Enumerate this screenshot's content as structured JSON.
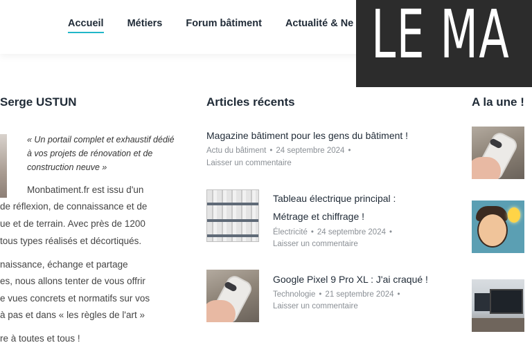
{
  "nav": {
    "items": [
      {
        "label": "Accueil",
        "active": true
      },
      {
        "label": "Métiers",
        "active": false
      },
      {
        "label": "Forum bâtiment",
        "active": false
      },
      {
        "label": "Actualité & Ne",
        "active": false
      }
    ],
    "accent_color": "#21b6c8"
  },
  "banner": {
    "text": "LE MA"
  },
  "about": {
    "title": "Serge USTUN",
    "quote": "« Un portail complet et exhaustif dédié à vos projets de rénovation et de construction neuve »",
    "lines": [
      "Monbatiment.fr est issu d'un",
      "de réflexion, de connaissance et de",
      "ue et de terrain. Avec près de 1200",
      "tous types réalisés et décortiqués.",
      "naissance, échange et partage",
      "es, nous allons tenter de vous offrir",
      "e vues concrets et normatifs sur vos",
      "à pas et dans « les règles de l'art »",
      "re à toutes et tous !"
    ]
  },
  "recent": {
    "title": "Articles récents",
    "articles": [
      {
        "title": "Magazine bâtiment pour les gens du bâtiment !",
        "category": "Actu du bâtiment",
        "date": "24 septembre 2024",
        "comment": "Laisser un commentaire",
        "thumb": "none"
      },
      {
        "title_line1": "Tableau électrique principal :",
        "title_line2": "Métrage et chiffrage !",
        "category": "Électricité",
        "date": "24 septembre 2024",
        "comment": "Laisser un commentaire",
        "thumb": "electrical-panel"
      },
      {
        "title": "Google Pixel 9 Pro XL : J'ai craqué !",
        "category": "Technologie",
        "date": "21 septembre 2024",
        "comment": "Laisser un commentaire",
        "thumb": "phone-in-hand"
      }
    ]
  },
  "featured": {
    "title": "A la une !",
    "thumbs": [
      "phone-in-hand",
      "cartoon-man-lightbulb",
      "office-desk-screens"
    ]
  }
}
